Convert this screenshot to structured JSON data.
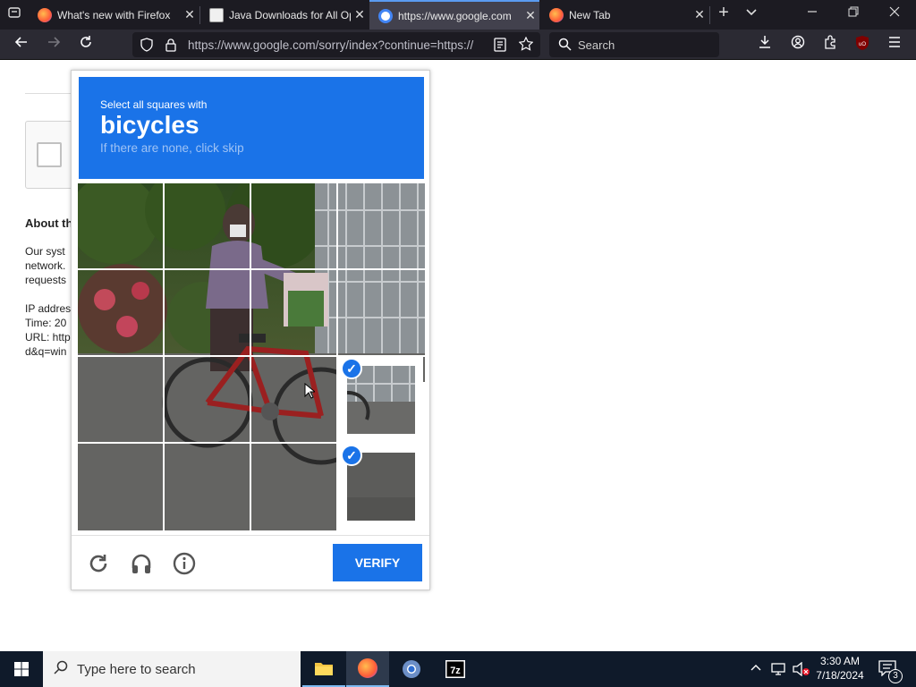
{
  "browser": {
    "tabs": [
      {
        "title": "What's new with Firefox",
        "favicon": "firefox-icon"
      },
      {
        "title": "Java Downloads for All Op",
        "favicon": "java-icon"
      },
      {
        "title": "https://www.google.com",
        "favicon": "google-icon"
      },
      {
        "title": "New Tab",
        "favicon": "firefox-icon"
      }
    ],
    "url": "https://www.google.com/sorry/index?continue=https://",
    "search_placeholder": "Search"
  },
  "page": {
    "about_heading": "About th",
    "para_lines": [
      "Our syst",
      "network.",
      "requests"
    ],
    "info_lines": [
      "IP addres",
      "Time: 20",
      "URL: http",
      "d&q=win"
    ]
  },
  "captcha": {
    "instruction": "Select all squares with",
    "target": "bicycles",
    "hint": "If there are none, click skip",
    "verify_label": "VERIFY",
    "selected_tiles": [
      11,
      15
    ],
    "colors": {
      "accent": "#1a73e8"
    }
  },
  "taskbar": {
    "search_placeholder": "Type here to search",
    "time": "3:30 AM",
    "date": "7/18/2024",
    "notification_count": "3"
  }
}
